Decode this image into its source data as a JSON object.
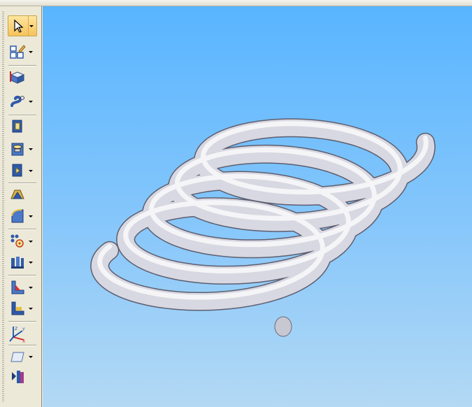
{
  "window": {
    "background": "#ece9d8",
    "accent": "#f7c25a"
  },
  "toolbar": {
    "items": [
      {
        "name": "select-tool",
        "icon": "arrow-cursor-icon",
        "dropdown": true,
        "active": true
      },
      {
        "name": "sketch-tool",
        "icon": "sketch-plane-icon",
        "dropdown": true
      },
      {
        "name": "extrude-tool",
        "icon": "extrude-block-icon",
        "dropdown": false
      },
      {
        "name": "helix-sweep-tool",
        "icon": "helix-sweep-icon",
        "dropdown": true
      },
      {
        "name": "cutout-tool",
        "icon": "cutout-icon",
        "dropdown": false
      },
      {
        "name": "hole-tool",
        "icon": "hole-icon",
        "dropdown": true
      },
      {
        "name": "revolve-cut-tool",
        "icon": "revolve-cut-icon",
        "dropdown": true
      },
      {
        "name": "shell-tool",
        "icon": "shell-dome-icon",
        "dropdown": false
      },
      {
        "name": "round-tool",
        "icon": "round-blend-icon",
        "dropdown": true
      },
      {
        "name": "pattern-tool",
        "icon": "pattern-icon",
        "dropdown": true
      },
      {
        "name": "thin-wall-tool",
        "icon": "thin-wall-icon",
        "dropdown": true
      },
      {
        "name": "rib-tool",
        "icon": "rib-icon",
        "dropdown": true
      },
      {
        "name": "web-network-tool",
        "icon": "web-network-icon",
        "dropdown": true
      },
      {
        "name": "coordinate-system-tool",
        "icon": "xyz-axes-icon",
        "dropdown": false
      },
      {
        "name": "reference-plane-tool",
        "icon": "plane-icon",
        "dropdown": true
      },
      {
        "name": "part-library-tool",
        "icon": "part-library-icon",
        "dropdown": false
      }
    ]
  },
  "viewport": {
    "model": "helical-spring",
    "sky_top": "#59b5ff",
    "sky_bottom": "#b3d9f4",
    "spring_color": "#d8d8e2"
  }
}
